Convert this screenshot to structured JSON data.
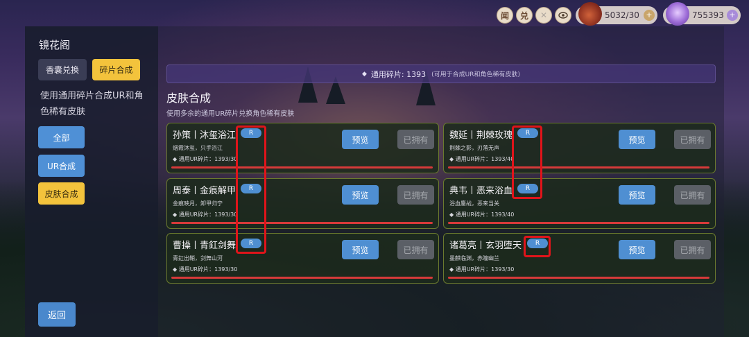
{
  "topbar": {
    "btn_wen": "闻",
    "btn_dui": "兑",
    "btn_x": "✕",
    "eye_icon": "eye-icon",
    "resource1": {
      "value": "5032/30",
      "icon": "money-bag-icon"
    },
    "resource2": {
      "value": "755393",
      "icon": "crystal-icon"
    }
  },
  "sidebar": {
    "title": "镜花阁",
    "tabs": [
      {
        "label": "香囊兑换",
        "active": false
      },
      {
        "label": "碎片合成",
        "active": true
      }
    ],
    "description": "使用通用碎片合成UR和角色稀有皮肤",
    "filters": [
      {
        "label": "全部",
        "active": false
      },
      {
        "label": "UR合成",
        "active": false
      },
      {
        "label": "皮肤合成",
        "active": true
      }
    ],
    "back_label": "返回"
  },
  "main": {
    "banner": {
      "text": "通用碎片: 1393",
      "note": "(可用于合成UR和角色稀有皮肤)"
    },
    "section_title": "皮肤合成",
    "section_subtitle": "使用多余的通用UR碎片兑换角色稀有皮肤",
    "cards": [
      {
        "name": "孙策丨沐玺浴江",
        "badge": "R",
        "desc": "烟霞沐玺，只手浴江",
        "frag": "◆ 通用UR碎片：1393/30",
        "preview": "预览",
        "owned": "已拥有"
      },
      {
        "name": "魏延丨荆棘玫瑰",
        "badge": "R",
        "desc": "荆棘之影，刃落无声",
        "frag": "◆ 通用UR碎片：1393/40",
        "preview": "预览",
        "owned": "已拥有"
      },
      {
        "name": "周泰丨金痕解甲",
        "badge": "R",
        "desc": "金痕映月，卸甲归宁",
        "frag": "◆ 通用UR碎片：1393/30",
        "preview": "预览",
        "owned": "已拥有"
      },
      {
        "name": "典韦丨恶来浴血",
        "badge": "R",
        "desc": "浴血鏖战，恶来当关",
        "frag": "◆ 通用UR碎片：1393/40",
        "preview": "预览",
        "owned": "已拥有"
      },
      {
        "name": "曹操丨青釭剑舞",
        "badge": "R",
        "desc": "青釭出鞘，剑舞山河",
        "frag": "◆ 通用UR碎片：1393/30",
        "preview": "预览",
        "owned": "已拥有"
      },
      {
        "name": "诸葛亮丨玄羽堕天",
        "badge": "R",
        "desc": "墨麒临渊，赤瞳幽兰",
        "frag": "◆ 通用UR碎片：1393/30",
        "preview": "预览",
        "owned": "已拥有"
      }
    ]
  },
  "colors": {
    "highlight": "#e0141a",
    "accent_blue": "#4f8fd2",
    "accent_gold": "#f3c33c"
  }
}
